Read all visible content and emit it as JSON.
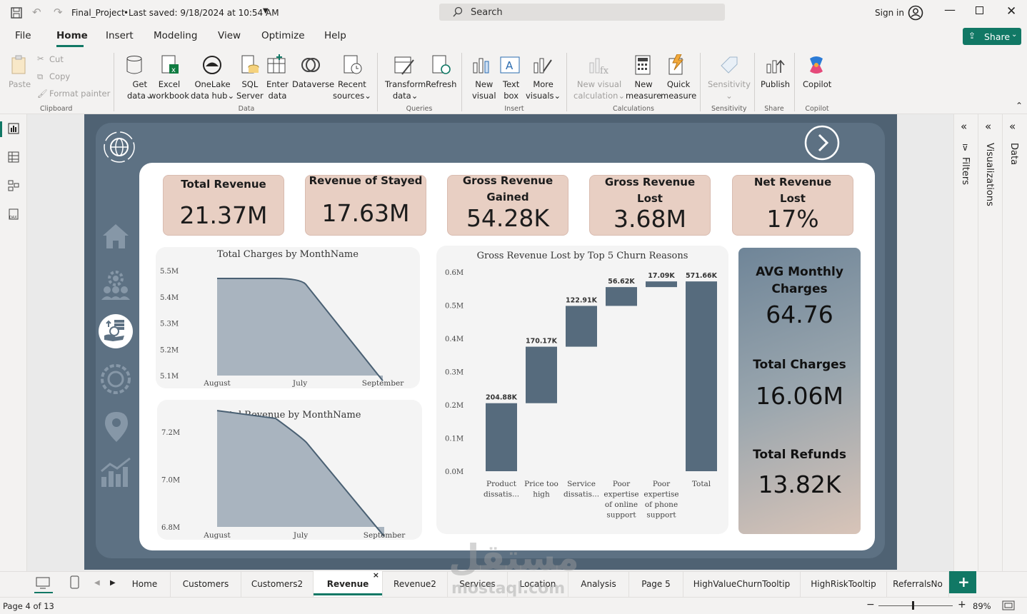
{
  "titlebar": {
    "file": "Final_Project",
    "saved": "Last saved: 9/18/2024 at 10:54 AM",
    "search": "Search",
    "signin": "Sign in"
  },
  "menu": {
    "file": "File",
    "home": "Home",
    "insert": "Insert",
    "modeling": "Modeling",
    "view": "View",
    "optimize": "Optimize",
    "help": "Help",
    "share": "Share"
  },
  "ribbon": {
    "paste": "Paste",
    "cut": "Cut",
    "copy": "Copy",
    "format_painter": "Format painter",
    "clipboard": "Clipboard",
    "get_data": "Get",
    "get_data2": "data",
    "excel": "Excel",
    "excel2": "workbook",
    "onelake": "OneLake",
    "onelake2": "data hub",
    "sql": "SQL",
    "sql2": "Server",
    "enter": "Enter",
    "enter2": "data",
    "dataverse": "Dataverse",
    "recent": "Recent",
    "recent2": "sources",
    "data_grp": "Data",
    "transform": "Transform",
    "transform2": "data",
    "refresh": "Refresh",
    "queries": "Queries",
    "new_visual": "New",
    "new_visual2": "visual",
    "textbox": "Text",
    "textbox2": "box",
    "more": "More",
    "more2": "visuals",
    "insert_grp": "Insert",
    "nvc": "New visual",
    "nvc2": "calculation",
    "nm": "New",
    "nm2": "measure",
    "qm": "Quick",
    "qm2": "measure",
    "calc_grp": "Calculations",
    "sens": "Sensitivity",
    "sens_grp": "Sensitivity",
    "publish": "Publish",
    "share_grp": "Share",
    "copilot": "Copilot",
    "copilot_grp": "Copilot"
  },
  "kpis": [
    {
      "label": "Total Revenue",
      "label2": "",
      "value": "21.37M"
    },
    {
      "label": "Revenue of Stayed",
      "label2": "",
      "value": "17.63M"
    },
    {
      "label": "Gross Revenue",
      "label2": "Gained",
      "value": "54.28K"
    },
    {
      "label": "Gross Revenue",
      "label2": "Lost",
      "value": "3.68M"
    },
    {
      "label": "Net Revenue",
      "label2": "Lost",
      "value": "17%"
    }
  ],
  "side": {
    "avg_label": "AVG Monthly",
    "avg_label2": "Charges",
    "avg_value": "64.76",
    "tc_label": "Total Charges",
    "tc_value": "16.06M",
    "tr_label": "Total Refunds",
    "tr_value": "13.82K"
  },
  "chart_data": [
    {
      "type": "area",
      "title": "Total Charges by MonthName",
      "categories": [
        "August",
        "July",
        "September"
      ],
      "values": [
        5.47,
        5.47,
        5.08
      ],
      "yticks": [
        "5.5M",
        "5.4M",
        "5.3M",
        "5.2M",
        "5.1M"
      ],
      "ylim": [
        5.1,
        5.5
      ]
    },
    {
      "type": "area",
      "title": "Total Revenue by MonthName",
      "categories": [
        "August",
        "July",
        "September"
      ],
      "values": [
        7.29,
        7.18,
        6.76
      ],
      "yticks": [
        "7.2M",
        "7.0M",
        "6.8M"
      ],
      "ylim": [
        6.8,
        7.2
      ]
    },
    {
      "type": "waterfall",
      "title": "Gross Revenue Lost by Top 5 Churn Reasons",
      "categories": [
        "Product dissatis...",
        "Price too high",
        "Service dissatis...",
        "Poor expertise of online support",
        "Poor expertise of phone support",
        "Total"
      ],
      "values": [
        204.88,
        170.17,
        122.91,
        56.62,
        17.09,
        571.66
      ],
      "labels": [
        "204.88K",
        "170.17K",
        "122.91K",
        "56.62K",
        "17.09K",
        "571.66K"
      ],
      "yticks": [
        "0.6M",
        "0.5M",
        "0.4M",
        "0.3M",
        "0.2M",
        "0.1M",
        "0.0M"
      ],
      "ylim": [
        0,
        0.6
      ]
    }
  ],
  "tabs": [
    "Home",
    "Customers",
    "Customers2",
    "Revenue",
    "Revenue2",
    "Services",
    "Location",
    "Analysis",
    "Page 5",
    "HighValueChurnTooltip",
    "HighRiskTooltip",
    "ReferralsNo"
  ],
  "panes": {
    "filters": "Filters",
    "visualizations": "Visualizations",
    "data": "Data"
  },
  "status": {
    "page": "Page 4 of 13",
    "zoom": "89%"
  },
  "watermark": {
    "arabic": "مستقل",
    "latin": "mostaql.com"
  },
  "colors": {
    "bar": "#566b7d",
    "kpi": "#e8cfc3",
    "accent": "#117865"
  }
}
